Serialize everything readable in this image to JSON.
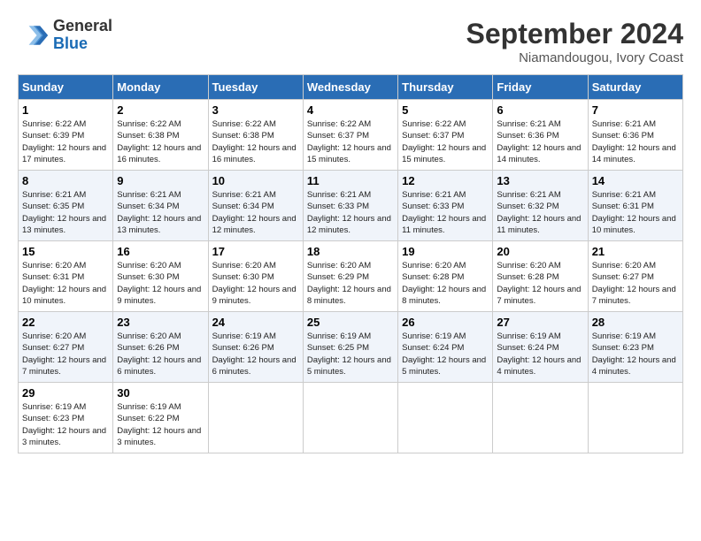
{
  "header": {
    "logo_line1": "General",
    "logo_line2": "Blue",
    "month": "September 2024",
    "location": "Niamandougou, Ivory Coast"
  },
  "weekdays": [
    "Sunday",
    "Monday",
    "Tuesday",
    "Wednesday",
    "Thursday",
    "Friday",
    "Saturday"
  ],
  "weeks": [
    [
      {
        "day": "1",
        "sunrise": "6:22 AM",
        "sunset": "6:39 PM",
        "daylight": "12 hours and 17 minutes."
      },
      {
        "day": "2",
        "sunrise": "6:22 AM",
        "sunset": "6:38 PM",
        "daylight": "12 hours and 16 minutes."
      },
      {
        "day": "3",
        "sunrise": "6:22 AM",
        "sunset": "6:38 PM",
        "daylight": "12 hours and 16 minutes."
      },
      {
        "day": "4",
        "sunrise": "6:22 AM",
        "sunset": "6:37 PM",
        "daylight": "12 hours and 15 minutes."
      },
      {
        "day": "5",
        "sunrise": "6:22 AM",
        "sunset": "6:37 PM",
        "daylight": "12 hours and 15 minutes."
      },
      {
        "day": "6",
        "sunrise": "6:21 AM",
        "sunset": "6:36 PM",
        "daylight": "12 hours and 14 minutes."
      },
      {
        "day": "7",
        "sunrise": "6:21 AM",
        "sunset": "6:36 PM",
        "daylight": "12 hours and 14 minutes."
      }
    ],
    [
      {
        "day": "8",
        "sunrise": "6:21 AM",
        "sunset": "6:35 PM",
        "daylight": "12 hours and 13 minutes."
      },
      {
        "day": "9",
        "sunrise": "6:21 AM",
        "sunset": "6:34 PM",
        "daylight": "12 hours and 13 minutes."
      },
      {
        "day": "10",
        "sunrise": "6:21 AM",
        "sunset": "6:34 PM",
        "daylight": "12 hours and 12 minutes."
      },
      {
        "day": "11",
        "sunrise": "6:21 AM",
        "sunset": "6:33 PM",
        "daylight": "12 hours and 12 minutes."
      },
      {
        "day": "12",
        "sunrise": "6:21 AM",
        "sunset": "6:33 PM",
        "daylight": "12 hours and 11 minutes."
      },
      {
        "day": "13",
        "sunrise": "6:21 AM",
        "sunset": "6:32 PM",
        "daylight": "12 hours and 11 minutes."
      },
      {
        "day": "14",
        "sunrise": "6:21 AM",
        "sunset": "6:31 PM",
        "daylight": "12 hours and 10 minutes."
      }
    ],
    [
      {
        "day": "15",
        "sunrise": "6:20 AM",
        "sunset": "6:31 PM",
        "daylight": "12 hours and 10 minutes."
      },
      {
        "day": "16",
        "sunrise": "6:20 AM",
        "sunset": "6:30 PM",
        "daylight": "12 hours and 9 minutes."
      },
      {
        "day": "17",
        "sunrise": "6:20 AM",
        "sunset": "6:30 PM",
        "daylight": "12 hours and 9 minutes."
      },
      {
        "day": "18",
        "sunrise": "6:20 AM",
        "sunset": "6:29 PM",
        "daylight": "12 hours and 8 minutes."
      },
      {
        "day": "19",
        "sunrise": "6:20 AM",
        "sunset": "6:28 PM",
        "daylight": "12 hours and 8 minutes."
      },
      {
        "day": "20",
        "sunrise": "6:20 AM",
        "sunset": "6:28 PM",
        "daylight": "12 hours and 7 minutes."
      },
      {
        "day": "21",
        "sunrise": "6:20 AM",
        "sunset": "6:27 PM",
        "daylight": "12 hours and 7 minutes."
      }
    ],
    [
      {
        "day": "22",
        "sunrise": "6:20 AM",
        "sunset": "6:27 PM",
        "daylight": "12 hours and 7 minutes."
      },
      {
        "day": "23",
        "sunrise": "6:20 AM",
        "sunset": "6:26 PM",
        "daylight": "12 hours and 6 minutes."
      },
      {
        "day": "24",
        "sunrise": "6:19 AM",
        "sunset": "6:26 PM",
        "daylight": "12 hours and 6 minutes."
      },
      {
        "day": "25",
        "sunrise": "6:19 AM",
        "sunset": "6:25 PM",
        "daylight": "12 hours and 5 minutes."
      },
      {
        "day": "26",
        "sunrise": "6:19 AM",
        "sunset": "6:24 PM",
        "daylight": "12 hours and 5 minutes."
      },
      {
        "day": "27",
        "sunrise": "6:19 AM",
        "sunset": "6:24 PM",
        "daylight": "12 hours and 4 minutes."
      },
      {
        "day": "28",
        "sunrise": "6:19 AM",
        "sunset": "6:23 PM",
        "daylight": "12 hours and 4 minutes."
      }
    ],
    [
      {
        "day": "29",
        "sunrise": "6:19 AM",
        "sunset": "6:23 PM",
        "daylight": "12 hours and 3 minutes."
      },
      {
        "day": "30",
        "sunrise": "6:19 AM",
        "sunset": "6:22 PM",
        "daylight": "12 hours and 3 minutes."
      },
      null,
      null,
      null,
      null,
      null
    ]
  ]
}
